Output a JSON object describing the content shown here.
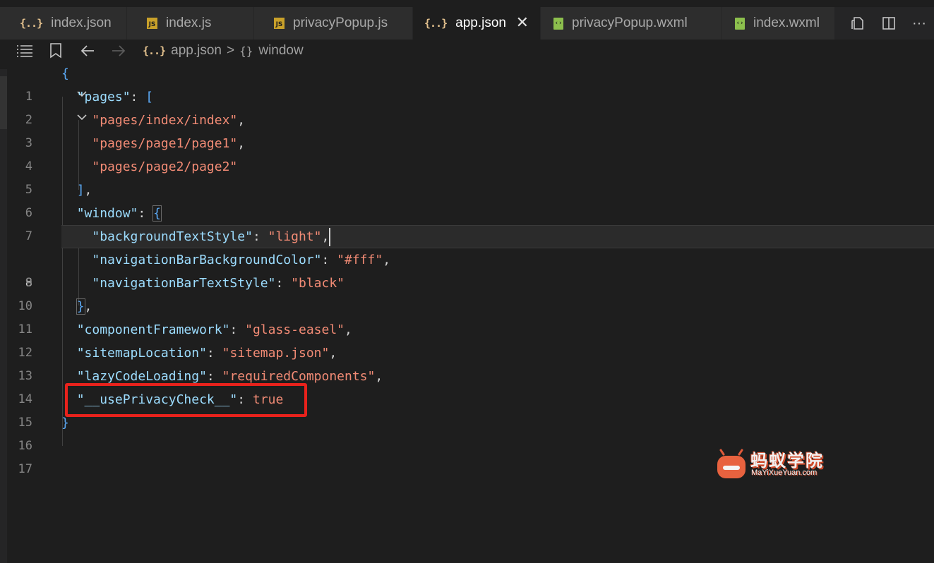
{
  "tabs": [
    {
      "label": "index.json",
      "icon": "json-file-icon",
      "active": false
    },
    {
      "label": "index.js",
      "icon": "js-file-icon",
      "active": false
    },
    {
      "label": "privacyPopup.js",
      "icon": "js-file-icon",
      "active": false
    },
    {
      "label": "app.json",
      "icon": "json-file-icon",
      "active": true
    },
    {
      "label": "privacyPopup.wxml",
      "icon": "wxml-file-icon",
      "active": false
    },
    {
      "label": "index.wxml",
      "icon": "wxml-file-icon",
      "active": false
    }
  ],
  "tab_actions": {
    "open_changes": "file-compare-icon",
    "split_editor": "split-editor-icon",
    "more": "···"
  },
  "breadcrumb": {
    "file": "app.json",
    "separator": ">",
    "object_symbol": "{}",
    "section": "window"
  },
  "breadcrumb_tools": [
    "list-icon",
    "bookmark-icon",
    "back-arrow-icon",
    "forward-arrow-icon"
  ],
  "editor": {
    "current_line": 8,
    "lines": [
      {
        "num": "1",
        "text": "{"
      },
      {
        "num": "2",
        "text": "\"pages\": ["
      },
      {
        "num": "3",
        "text": "\"pages/index/index\","
      },
      {
        "num": "4",
        "text": "\"pages/page1/page1\","
      },
      {
        "num": "5",
        "text": "\"pages/page2/page2\""
      },
      {
        "num": "6",
        "text": "],"
      },
      {
        "num": "7",
        "text": "\"window\": {"
      },
      {
        "num": "8",
        "text": "\"backgroundTextStyle\": \"light\","
      },
      {
        "num": "9",
        "text": "\"navigationBarBackgroundColor\": \"#fff\","
      },
      {
        "num": "10",
        "text": "\"navigationBarTextStyle\": \"black\""
      },
      {
        "num": "11",
        "text": "},"
      },
      {
        "num": "12",
        "text": "\"componentFramework\": \"glass-easel\","
      },
      {
        "num": "13",
        "text": "\"sitemapLocation\": \"sitemap.json\","
      },
      {
        "num": "14",
        "text": "\"lazyCodeLoading\": \"requiredComponents\","
      },
      {
        "num": "15",
        "text": "\"__usePrivacyCheck__\": true"
      },
      {
        "num": "16",
        "text": "}"
      },
      {
        "num": "17",
        "text": ""
      }
    ]
  },
  "watermark": {
    "title": "蚂蚁学院",
    "subtitle": "MaYiXueYuan.com"
  },
  "colors": {
    "key": "#9cdcfe",
    "string": "#f28b75",
    "bracket": "#5ba9f5",
    "highlight_box": "#e8221c"
  }
}
